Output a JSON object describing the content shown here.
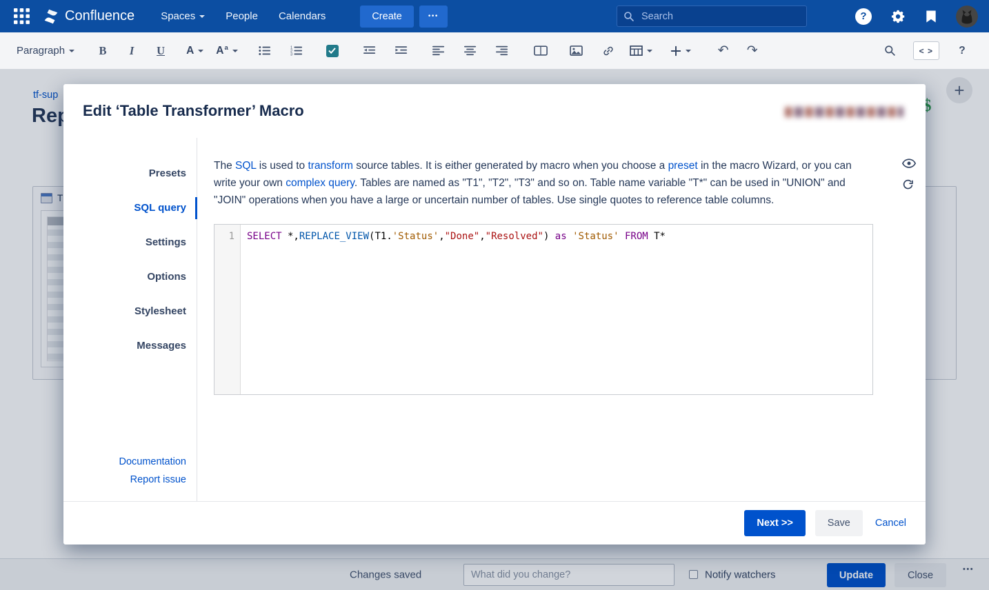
{
  "colors": {
    "header_bg": "#0C4EA2",
    "header_btn": "#2169CE",
    "search_bg": "#09418F",
    "toolbar_bg": "#F4F5F7",
    "toolbar_icon": "#44546F",
    "accent": "#0052CC",
    "link": "#0052CC",
    "text": "#172B4D",
    "task_icon": "#217A8A",
    "code_keyword": "#770088",
    "code_builtin": "#0055AA",
    "code_string": "#AA1111",
    "code_string2": "#A05A00",
    "dollar_green": "#2E9E49"
  },
  "header": {
    "app_name": "Confluence",
    "nav_spaces": "Spaces",
    "nav_people": "People",
    "nav_calendars": "Calendars",
    "create_label": "Create",
    "more_glyph": "•••",
    "search_placeholder": "Search",
    "help_label": "?"
  },
  "toolbar": {
    "paragraph_label": "Paragraph",
    "bold_label": "B",
    "italic_label": "I",
    "underline_label": "U",
    "text_color_label": "A",
    "format_label": "A",
    "format_label_small": "a",
    "undo_glyph": "↶",
    "redo_glyph": "↷",
    "source_label": "< >",
    "help_label": "?"
  },
  "page_background": {
    "breadcrumb": "tf-sup",
    "heading": "Rep",
    "macro_label": "T",
    "dollar_glyph": "$",
    "plus_glyph": "+"
  },
  "modal": {
    "title": "Edit ‘Table Transformer’ Macro",
    "sidebar_items": [
      {
        "label": "Presets",
        "active": false
      },
      {
        "label": "SQL query",
        "active": true
      },
      {
        "label": "Settings",
        "active": false
      },
      {
        "label": "Options",
        "active": false
      },
      {
        "label": "Stylesheet",
        "active": false
      },
      {
        "label": "Messages",
        "active": false
      }
    ],
    "sidebar_links": [
      "Documentation",
      "Report issue"
    ],
    "description_segments": [
      {
        "text": "The ",
        "link": false
      },
      {
        "text": "SQL",
        "link": true
      },
      {
        "text": " is used to ",
        "link": false
      },
      {
        "text": "transform",
        "link": true
      },
      {
        "text": " source tables. It is either generated by macro when you choose a ",
        "link": false
      },
      {
        "text": "preset",
        "link": true
      },
      {
        "text": " in the macro Wizard, or you can write your own ",
        "link": false
      },
      {
        "text": "complex query",
        "link": true
      },
      {
        "text": ". Tables are named as \"T1\", \"T2\", \"T3\" and so on. Table name variable \"T*\" can be used in \"UNION\" and \"JOIN\" operations when you have a large or uncertain number of tables. Use single quotes to reference table columns.",
        "link": false
      }
    ],
    "editor": {
      "line_number": "1",
      "tokens": [
        {
          "text": "SELECT",
          "type": "keyword"
        },
        {
          "text": " *,",
          "type": "plain"
        },
        {
          "text": "REPLACE_VIEW",
          "type": "builtin"
        },
        {
          "text": "(T1.",
          "type": "plain"
        },
        {
          "text": "'Status'",
          "type": "string2"
        },
        {
          "text": ",",
          "type": "plain"
        },
        {
          "text": "\"Done\"",
          "type": "string"
        },
        {
          "text": ",",
          "type": "plain"
        },
        {
          "text": "\"Resolved\"",
          "type": "string"
        },
        {
          "text": ") ",
          "type": "plain"
        },
        {
          "text": "as",
          "type": "keyword"
        },
        {
          "text": " ",
          "type": "plain"
        },
        {
          "text": "'Status'",
          "type": "string2"
        },
        {
          "text": " ",
          "type": "plain"
        },
        {
          "text": "FROM",
          "type": "keyword"
        },
        {
          "text": " T*",
          "type": "plain"
        }
      ]
    },
    "footer": {
      "next_label": "Next >>",
      "save_label": "Save",
      "cancel_label": "Cancel"
    }
  },
  "bottom_bar": {
    "status_text": "Changes saved",
    "comment_placeholder": "What did you change?",
    "notify_label": "Notify watchers",
    "update_label": "Update",
    "close_label": "Close",
    "more_glyph": "•••"
  }
}
